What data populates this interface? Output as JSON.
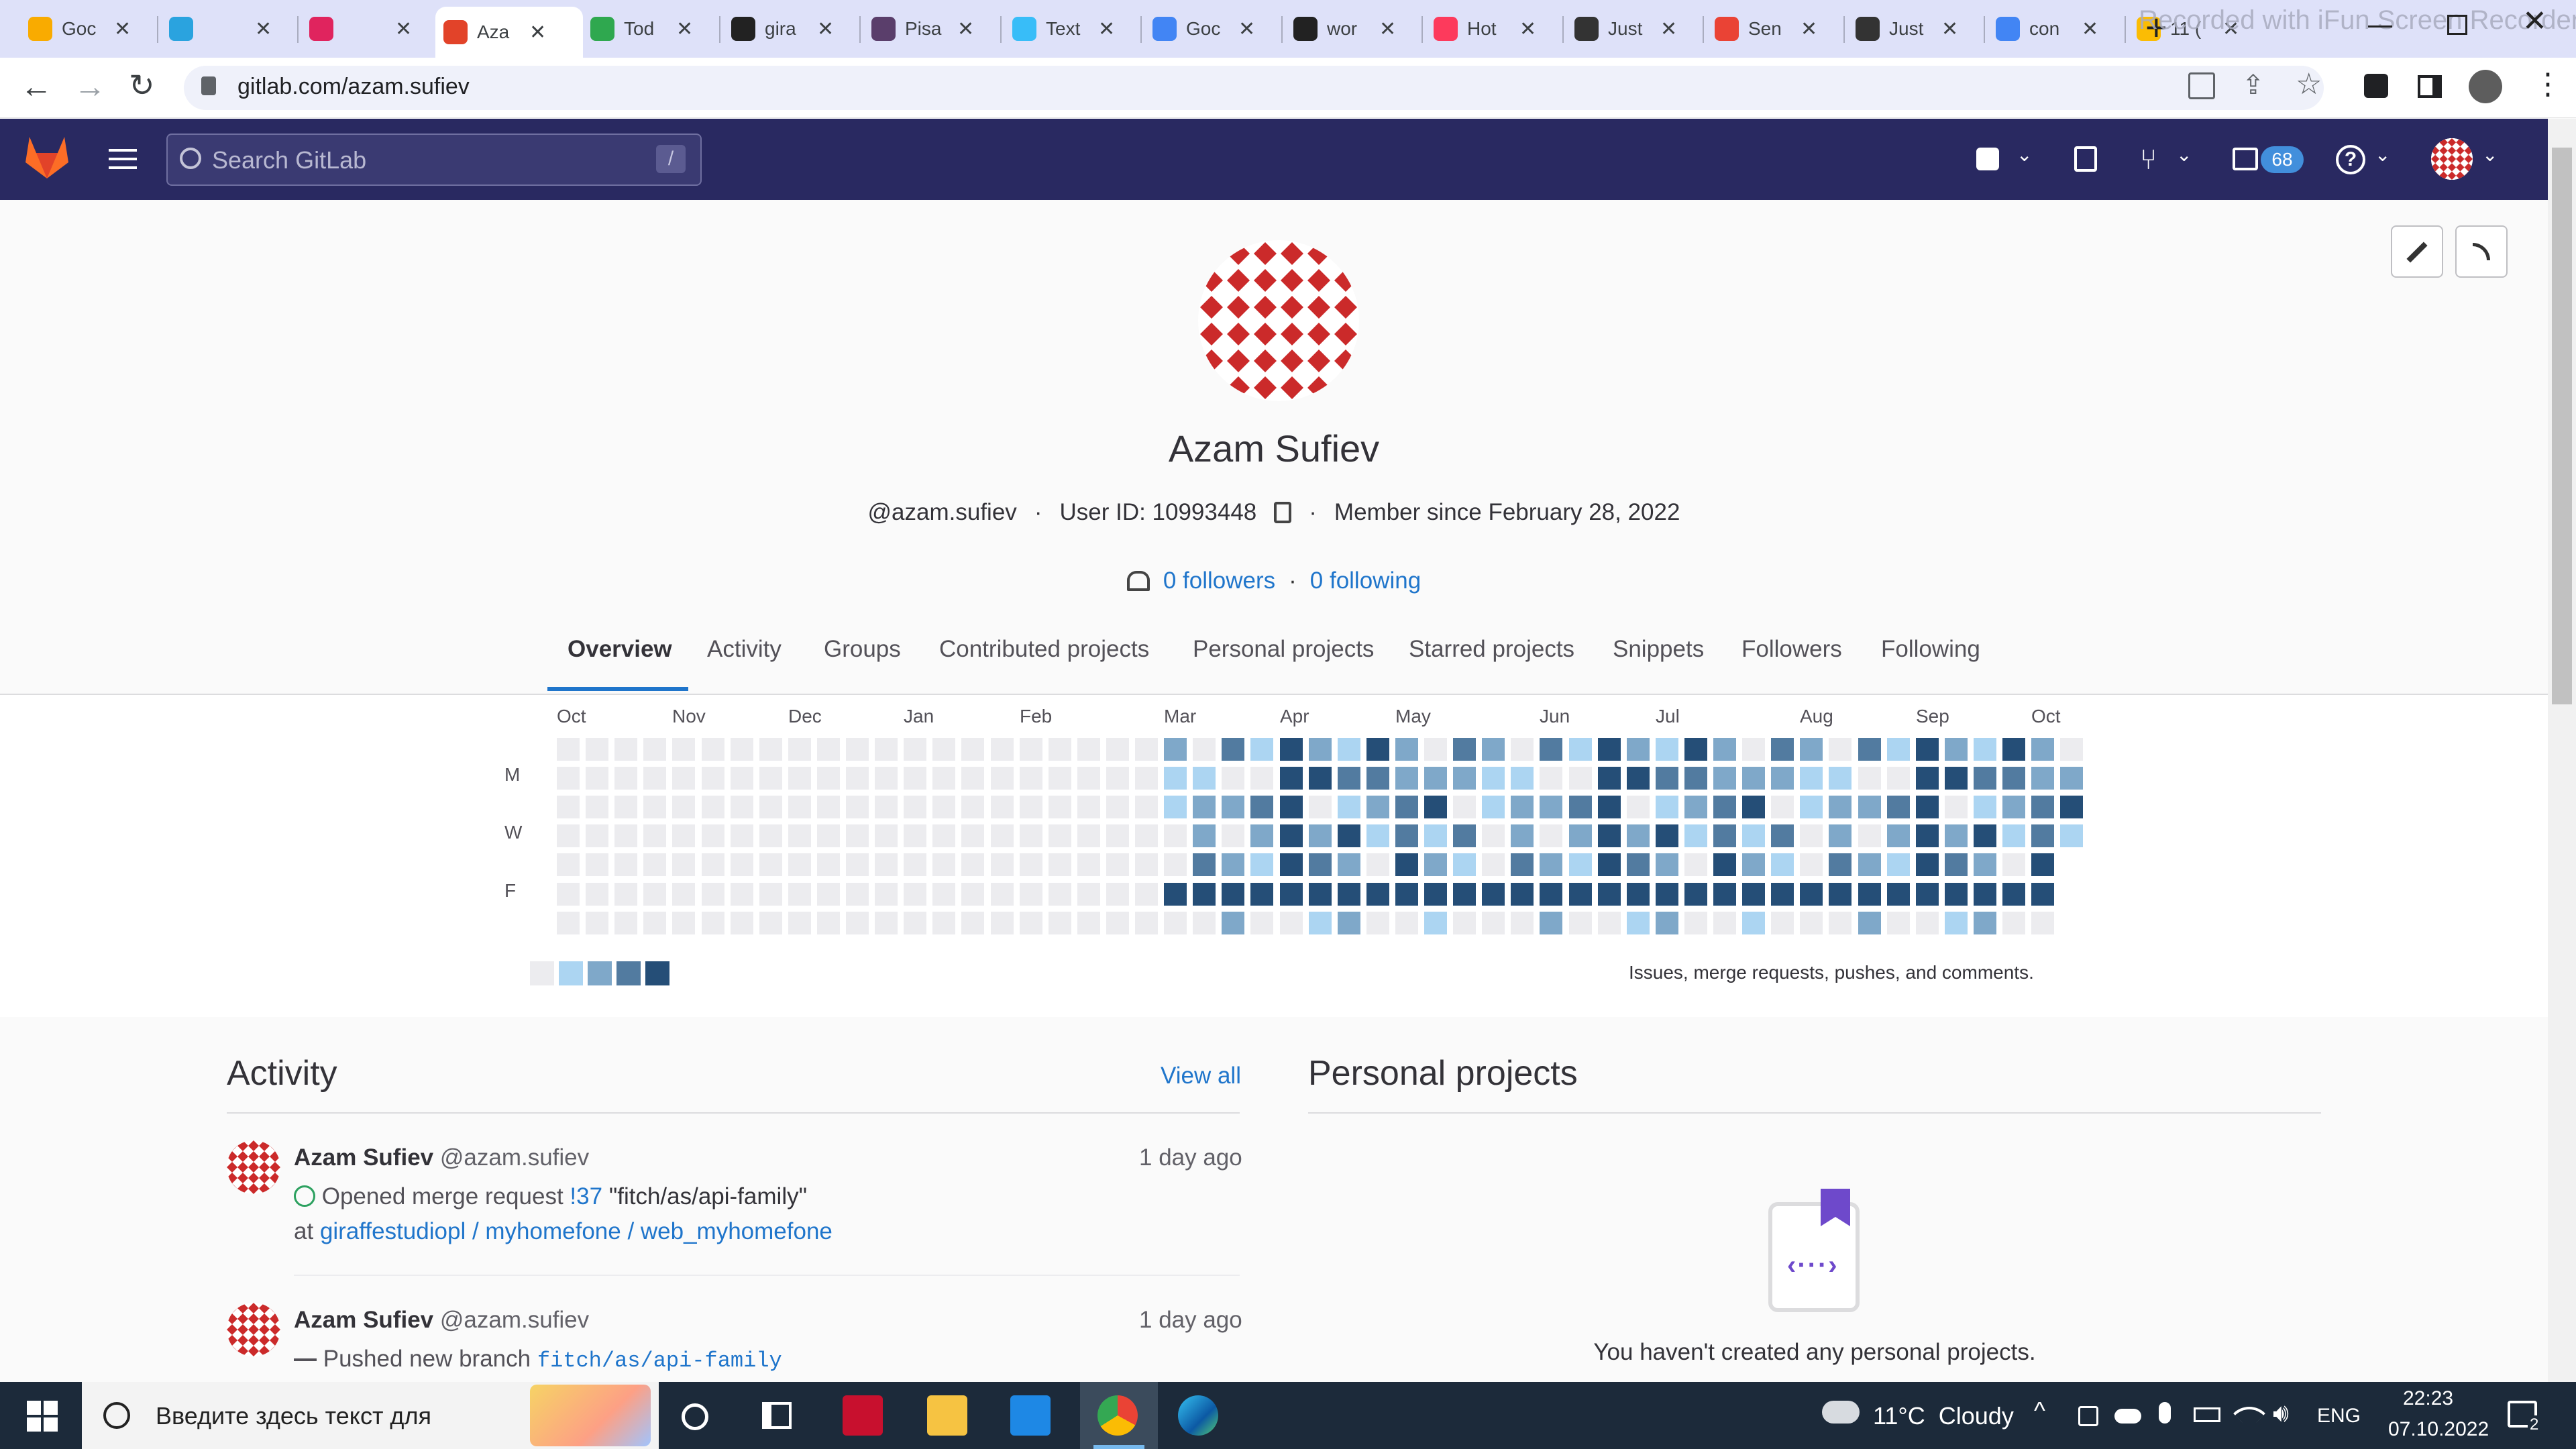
{
  "browser": {
    "tabs": [
      {
        "title": "Goc",
        "icon": "keep-notes-icon",
        "color": "#f9ab00"
      },
      {
        "title": "",
        "icon": "telegram-icon",
        "color": "#2aa3df"
      },
      {
        "title": "",
        "icon": "record-icon",
        "color": "#e0245e"
      },
      {
        "title": "Aza",
        "icon": "gitlab-icon",
        "color": "#e24329",
        "active": true
      },
      {
        "title": "Tod",
        "icon": "todo-check-icon",
        "color": "#2fa84f"
      },
      {
        "title": "gira",
        "icon": "giraffe-icon",
        "color": "#222222"
      },
      {
        "title": "Pisa",
        "icon": "pisa-icon",
        "color": "#5a3e6b"
      },
      {
        "title": "Text",
        "icon": "tailwind-icon",
        "color": "#38bdf8"
      },
      {
        "title": "Goc",
        "icon": "google-translate-icon",
        "color": "#4285f4"
      },
      {
        "title": "wor",
        "icon": "angular-icon",
        "color": "#222222"
      },
      {
        "title": "Hot",
        "icon": "hotjar-icon",
        "color": "#fd3a5c"
      },
      {
        "title": "Just",
        "icon": "jetbrains-icon",
        "color": "#333333"
      },
      {
        "title": "Sen",
        "icon": "gmail-icon",
        "color": "#ea4335"
      },
      {
        "title": "Just",
        "icon": "jetbrains-icon",
        "color": "#333333"
      },
      {
        "title": "con",
        "icon": "google-icon",
        "color": "#4285f4"
      },
      {
        "title": "11 (",
        "icon": "yellow-circle-icon",
        "color": "#fbbc04"
      }
    ],
    "new_tab": "+",
    "watermark": "Recorded with iFun Screen Recorder",
    "url": "gitlab.com/azam.sufiev"
  },
  "gitlab": {
    "search_placeholder": "Search GitLab",
    "search_shortcut": "/",
    "todo_count": "68"
  },
  "profile": {
    "name": "Azam Sufiev",
    "username": "@azam.sufiev",
    "user_id": "User ID: 10993448",
    "member_since": "Member since February 28, 2022",
    "followers": "0 followers",
    "following": "0 following",
    "tabs": [
      "Overview",
      "Activity",
      "Groups",
      "Contributed projects",
      "Personal projects",
      "Starred projects",
      "Snippets",
      "Followers",
      "Following"
    ],
    "active_tab": "Overview"
  },
  "calendar": {
    "months": [
      "Oct",
      "Nov",
      "Dec",
      "Jan",
      "Feb",
      "Mar",
      "Apr",
      "May",
      "Jun",
      "Jul",
      "Aug",
      "Sep",
      "Oct"
    ],
    "day_labels": [
      "M",
      "W",
      "F"
    ],
    "levels": [
      "#ececef",
      "#acd5f2",
      "#7fa8c9",
      "#527ba0",
      "#254e77"
    ],
    "legend_text": "Issues, merge requests, pushes, and comments."
  },
  "activity": {
    "title": "Activity",
    "view_all": "View all",
    "events": [
      {
        "author": "Azam Sufiev",
        "handle": "@azam.sufiev",
        "time": "1 day ago",
        "action": "Opened merge request",
        "ref": "!37",
        "ref_title": "\"fitch/as/api-family\"",
        "at": "at",
        "project": "giraffestudiopl / myhomefone / web_myhomefone"
      },
      {
        "author": "Azam Sufiev",
        "handle": "@azam.sufiev",
        "time": "1 day ago",
        "action": "Pushed new branch",
        "ref": "fitch/as/api-family"
      }
    ]
  },
  "personal_projects": {
    "title": "Personal projects",
    "empty": "You haven't created any personal projects."
  },
  "taskbar": {
    "search_placeholder": "Введите здесь текст для",
    "weather": "11°C  Cloudy",
    "lang": "ENG",
    "time": "22:23",
    "date": "07.10.2022",
    "notifications": "2"
  }
}
